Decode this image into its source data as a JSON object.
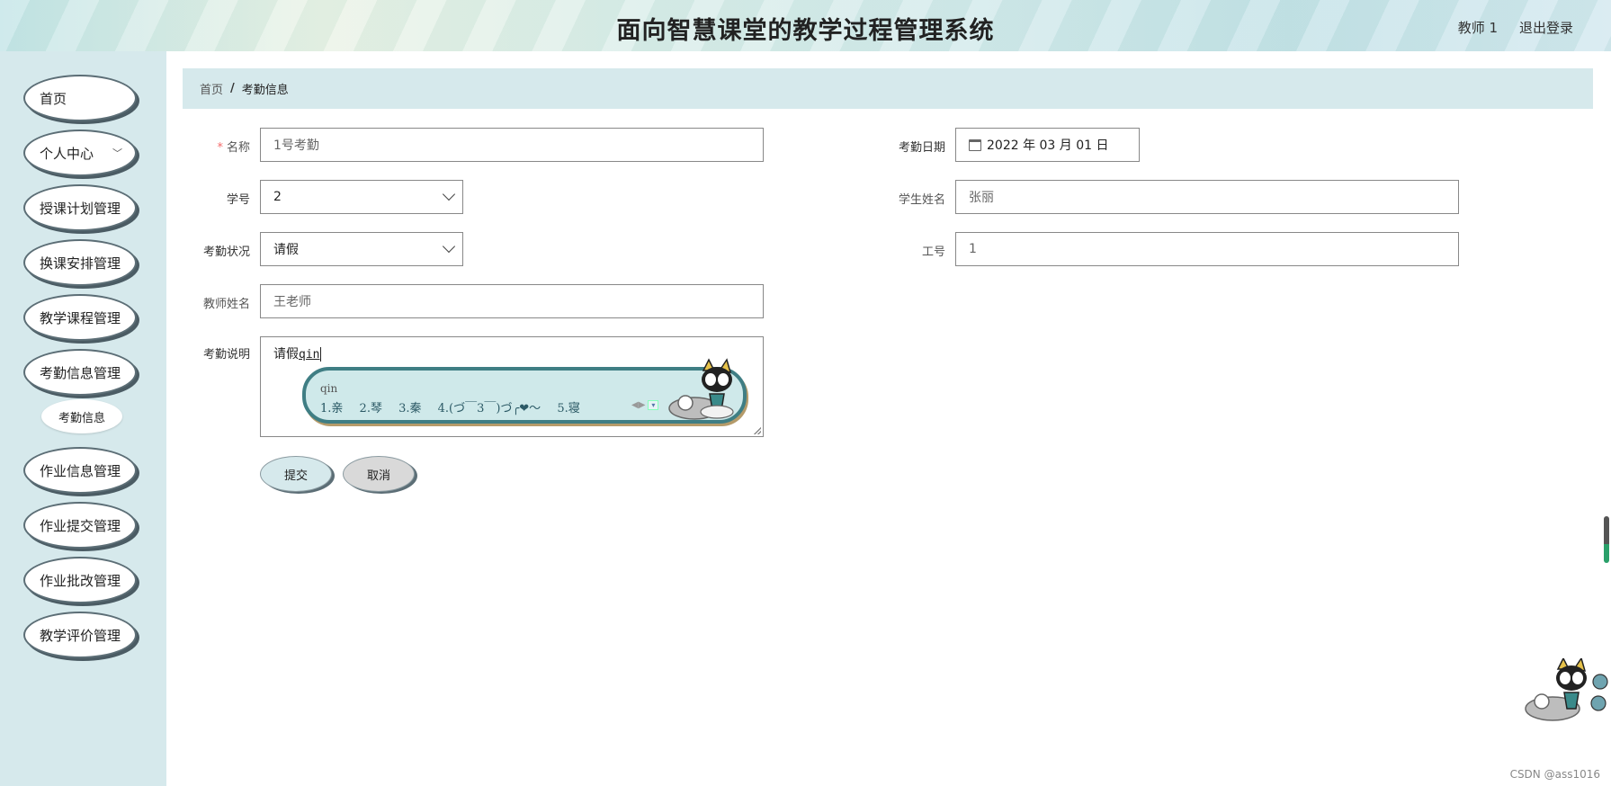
{
  "header": {
    "title": "面向智慧课堂的教学过程管理系统",
    "user": "教师 1",
    "logout": "退出登录"
  },
  "sidebar": {
    "items": [
      {
        "label": "首页"
      },
      {
        "label": "个人中心"
      },
      {
        "label": "授课计划管理"
      },
      {
        "label": "换课安排管理"
      },
      {
        "label": "教学课程管理"
      },
      {
        "label": "考勤信息管理"
      },
      {
        "label": "作业信息管理"
      },
      {
        "label": "作业提交管理"
      },
      {
        "label": "作业批改管理"
      },
      {
        "label": "教学评价管理"
      }
    ],
    "sub_item": "考勤信息"
  },
  "breadcrumb": {
    "home": "首页",
    "separator": "/",
    "current": "考勤信息"
  },
  "form": {
    "name": {
      "label": "名称",
      "value": "1号考勤"
    },
    "date": {
      "label": "考勤日期",
      "value": "2022 年 03 月 01 日"
    },
    "student_no": {
      "label": "学号",
      "value": "2"
    },
    "student_name": {
      "label": "学生姓名",
      "value": "张丽"
    },
    "status": {
      "label": "考勤状况",
      "value": "请假"
    },
    "staff_no": {
      "label": "工号",
      "value": "1"
    },
    "teacher_name": {
      "label": "教师姓名",
      "value": "王老师"
    },
    "note": {
      "label": "考勤说明",
      "value": "请假",
      "composing": "qin"
    }
  },
  "ime": {
    "typed": "qin",
    "candidates": [
      "1.亲",
      "2.琴",
      "3.秦",
      "4.(づ￣3￣)づ╭❤～",
      "5.寝"
    ]
  },
  "buttons": {
    "submit": "提交",
    "cancel": "取消"
  },
  "watermark": "CSDN @ass1016",
  "colors": {
    "sidebar_bg": "#d6e9ec",
    "required": "#f56c6c"
  }
}
